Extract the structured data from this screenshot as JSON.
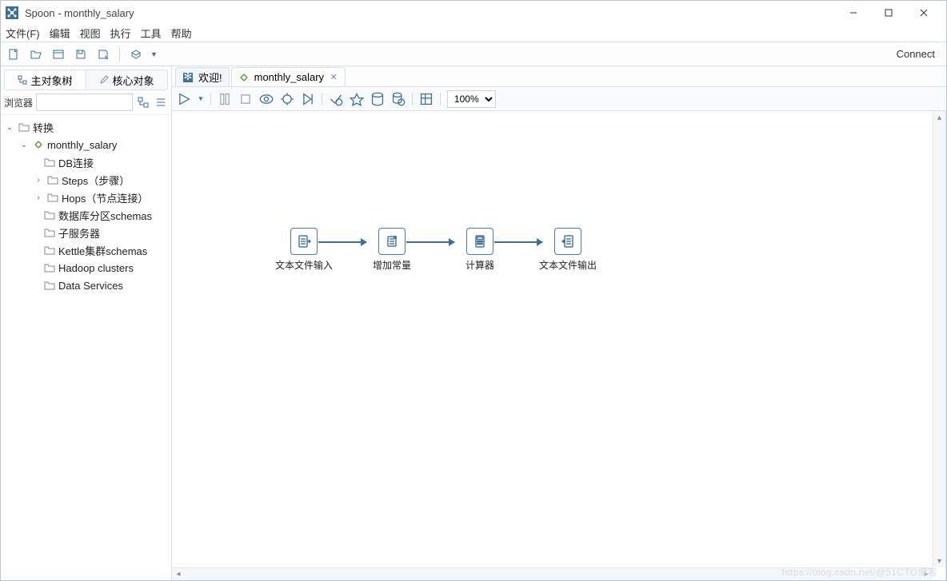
{
  "window": {
    "title": "Spoon - monthly_salary"
  },
  "menu": {
    "file": "文件(F)",
    "edit": "编辑",
    "view": "视图",
    "run": "执行",
    "tools": "工具",
    "help": "帮助"
  },
  "toolbar": {
    "connect": "Connect"
  },
  "left": {
    "tab1": "主对象树",
    "tab2": "核心对象",
    "browse_label": "浏览器",
    "search_placeholder": "",
    "tree": {
      "root": "转换",
      "trans": "monthly_salary",
      "children": {
        "db": "DB连接",
        "steps": "Steps（步骤）",
        "hops": "Hops（节点连接）",
        "partition": "数据库分区schemas",
        "slave": "子服务器",
        "cluster": "Kettle集群schemas",
        "hadoop": "Hadoop clusters",
        "dataservices": "Data Services"
      }
    }
  },
  "tabs": {
    "welcome": "欢迎!",
    "trans": "monthly_salary"
  },
  "canvas": {
    "zoom": "100%",
    "steps": {
      "s1": "文本文件输入",
      "s2": "增加常量",
      "s3": "计算器",
      "s4": "文本文件输出"
    }
  },
  "watermark": "https://blog.csdn.net/@51CTO博客"
}
